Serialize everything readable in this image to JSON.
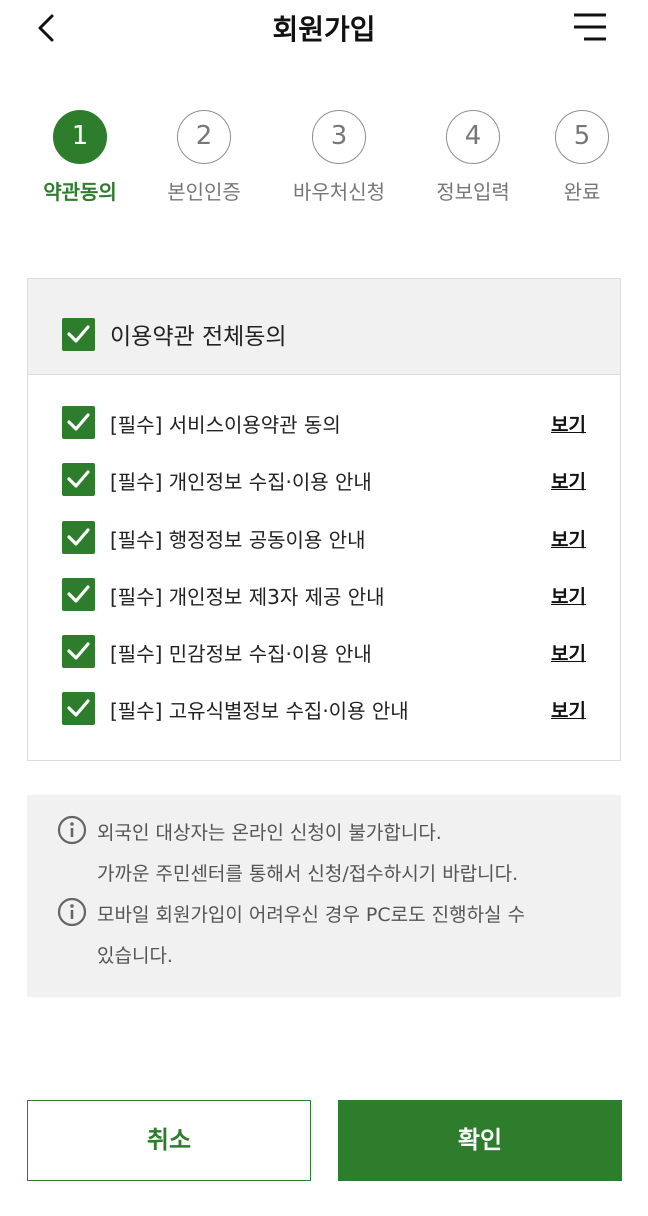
{
  "header": {
    "title": "회원가입",
    "back_icon": "chevron-left-icon",
    "menu_icon": "hamburger-menu-icon"
  },
  "steps": [
    {
      "number": "1",
      "label": "약관동의",
      "active": true
    },
    {
      "number": "2",
      "label": "본인인증",
      "active": false
    },
    {
      "number": "3",
      "label": "바우처신청",
      "active": false
    },
    {
      "number": "4",
      "label": "정보입력",
      "active": false
    },
    {
      "number": "5",
      "label": "완료",
      "active": false
    }
  ],
  "agreement": {
    "all_label": "이용약관 전체동의",
    "all_checked": true,
    "terms": [
      {
        "label": "[필수] 서비스이용약관 동의",
        "view": "보기",
        "checked": true
      },
      {
        "label": "[필수] 개인정보 수집·이용 안내",
        "view": "보기",
        "checked": true
      },
      {
        "label": "[필수] 행정정보 공동이용 안내",
        "view": "보기",
        "checked": true
      },
      {
        "label": "[필수] 개인정보 제3자 제공 안내",
        "view": "보기",
        "checked": true
      },
      {
        "label": "[필수] 민감정보 수집·이용 안내",
        "view": "보기",
        "checked": true
      },
      {
        "label": "[필수] 고유식별정보 수집·이용 안내",
        "view": "보기",
        "checked": true
      }
    ]
  },
  "notices": [
    {
      "icon": "info-icon",
      "lines": [
        "외국인 대상자는 온라인 신청이 불가합니다.",
        "가까운 주민센터를 통해서 신청/접수하시기 바랍니다."
      ]
    },
    {
      "icon": "info-icon",
      "lines": [
        "모바일 회원가입이 어려우신 경우 PC로도 진행하실 수",
        "있습니다."
      ]
    }
  ],
  "buttons": {
    "cancel": "취소",
    "confirm": "확인"
  },
  "colors": {
    "accent": "#2d7d2d",
    "panel_bg": "#f1f1f1"
  }
}
